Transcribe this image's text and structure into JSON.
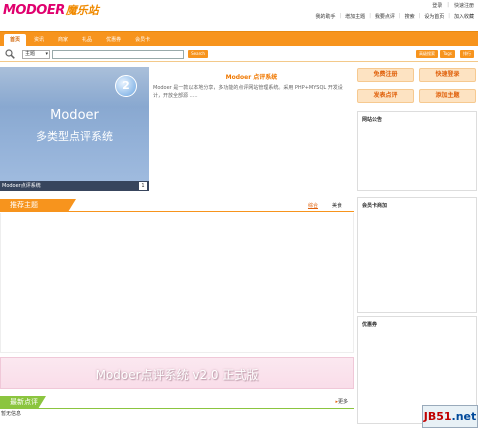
{
  "header": {
    "logo_en": "MODOER",
    "logo_cn": "魔乐站",
    "top_links": [
      "登录",
      "快速注册"
    ],
    "user_links": [
      "我的助手",
      "增加主题",
      "我要点评",
      "搜索",
      "设为首页",
      "加入收藏"
    ]
  },
  "nav": {
    "tabs": [
      {
        "label": "首页",
        "active": true
      },
      {
        "label": "资讯",
        "active": false
      },
      {
        "label": "商家",
        "active": false
      },
      {
        "label": "礼品",
        "active": false
      },
      {
        "label": "优惠券",
        "active": false
      },
      {
        "label": "会员卡",
        "active": false
      }
    ]
  },
  "search": {
    "scope_value": "主题",
    "query": "",
    "button_label": "Search",
    "right_buttons": [
      "高级搜索",
      "Tags",
      "排行"
    ]
  },
  "banner": {
    "badge": "2",
    "title": "Modoer",
    "subtitle": "多类型点评系统",
    "caption": "Modoer点评系统",
    "index": "1"
  },
  "intro": {
    "title": "Modoer 点评系统",
    "text": "Modoer 是一款以本地分享，多功能的点评网站管理系统。采用 PHP+MYSQL 开发设计，开放全部源 ....."
  },
  "actions": {
    "register": "免费注册",
    "login": "快速登录",
    "post_review": "发表点评",
    "add_subject": "添加主题"
  },
  "panels": {
    "announcement": "网站公告",
    "member_card": "会员卡商加",
    "coupons": "优惠券"
  },
  "recommend": {
    "title": "推荐主题",
    "tabs": [
      {
        "label": "综合",
        "active": true
      },
      {
        "label": "美食",
        "active": false
      }
    ]
  },
  "ad": {
    "text": "Modoer点评系统 v2.0 正式版"
  },
  "latest": {
    "title": "最新点评",
    "more": "更多",
    "items": [
      "暂无信息"
    ]
  },
  "watermark": {
    "left": "JB51",
    "right": ".net"
  },
  "colors": {
    "accent": "#f7941d",
    "green": "#8bc53f",
    "brand_pink": "#e0006e"
  }
}
